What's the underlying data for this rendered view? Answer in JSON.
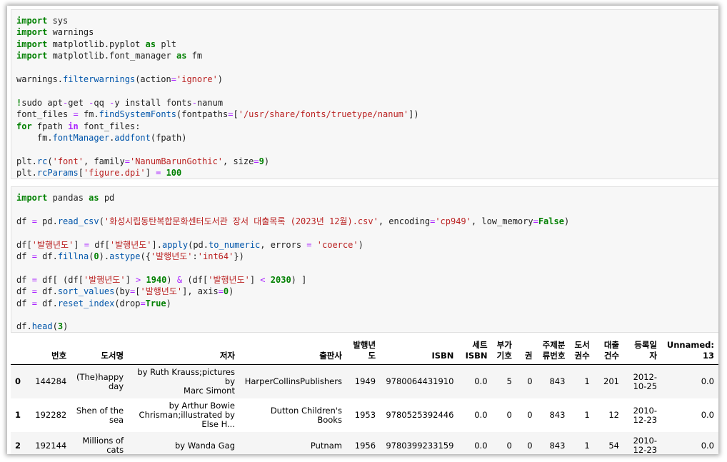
{
  "cells": [
    {
      "lines": [
        [
          {
            "t": "k",
            "v": "import"
          },
          {
            "t": "",
            "v": " sys"
          }
        ],
        [
          {
            "t": "k",
            "v": "import"
          },
          {
            "t": "",
            "v": " warnings"
          }
        ],
        [
          {
            "t": "k",
            "v": "import"
          },
          {
            "t": "",
            "v": " matplotlib.pyplot "
          },
          {
            "t": "k",
            "v": "as"
          },
          {
            "t": "",
            "v": " plt"
          }
        ],
        [
          {
            "t": "k",
            "v": "import"
          },
          {
            "t": "",
            "v": " matplotlib.font_manager "
          },
          {
            "t": "k",
            "v": "as"
          },
          {
            "t": "",
            "v": " fm"
          }
        ],
        [],
        [
          {
            "t": "",
            "v": "warnings."
          },
          {
            "t": "f",
            "v": "filterwarnings"
          },
          {
            "t": "",
            "v": "(action"
          },
          {
            "t": "o",
            "v": "="
          },
          {
            "t": "s",
            "v": "'ignore'"
          },
          {
            "t": "",
            "v": ")"
          }
        ],
        [],
        [
          {
            "t": "k",
            "v": "!"
          },
          {
            "t": "",
            "v": "sudo apt"
          },
          {
            "t": "o",
            "v": "-"
          },
          {
            "t": "",
            "v": "get "
          },
          {
            "t": "o",
            "v": "-"
          },
          {
            "t": "",
            "v": "qq "
          },
          {
            "t": "o",
            "v": "-"
          },
          {
            "t": "",
            "v": "y install fonts"
          },
          {
            "t": "o",
            "v": "-"
          },
          {
            "t": "",
            "v": "nanum"
          }
        ],
        [
          {
            "t": "",
            "v": "font_files "
          },
          {
            "t": "o",
            "v": "="
          },
          {
            "t": "",
            "v": " fm."
          },
          {
            "t": "f",
            "v": "findSystemFonts"
          },
          {
            "t": "",
            "v": "(fontpaths"
          },
          {
            "t": "o",
            "v": "="
          },
          {
            "t": "",
            "v": "["
          },
          {
            "t": "s",
            "v": "'/usr/share/fonts/truetype/nanum'"
          },
          {
            "t": "",
            "v": "])"
          }
        ],
        [
          {
            "t": "k",
            "v": "for"
          },
          {
            "t": "",
            "v": " fpath "
          },
          {
            "t": "n",
            "v": "in"
          },
          {
            "t": "",
            "v": " font_files:"
          }
        ],
        [
          {
            "t": "",
            "v": "    fm."
          },
          {
            "t": "f",
            "v": "fontManager"
          },
          {
            "t": "",
            "v": "."
          },
          {
            "t": "f",
            "v": "addfont"
          },
          {
            "t": "",
            "v": "(fpath)"
          }
        ],
        [],
        [
          {
            "t": "",
            "v": "plt."
          },
          {
            "t": "f",
            "v": "rc"
          },
          {
            "t": "",
            "v": "("
          },
          {
            "t": "s",
            "v": "'font'"
          },
          {
            "t": "",
            "v": ", family"
          },
          {
            "t": "o",
            "v": "="
          },
          {
            "t": "s",
            "v": "'NanumBarunGothic'"
          },
          {
            "t": "",
            "v": ", size"
          },
          {
            "t": "o",
            "v": "="
          },
          {
            "t": "k",
            "v": "9"
          },
          {
            "t": "",
            "v": ")"
          }
        ],
        [
          {
            "t": "",
            "v": "plt."
          },
          {
            "t": "f",
            "v": "rcParams"
          },
          {
            "t": "",
            "v": "["
          },
          {
            "t": "s",
            "v": "'figure.dpi'"
          },
          {
            "t": "",
            "v": "] "
          },
          {
            "t": "o",
            "v": "="
          },
          {
            "t": "",
            "v": " "
          },
          {
            "t": "k",
            "v": "100"
          }
        ]
      ]
    },
    {
      "lines": [
        [
          {
            "t": "k",
            "v": "import"
          },
          {
            "t": "",
            "v": " pandas "
          },
          {
            "t": "k",
            "v": "as"
          },
          {
            "t": "",
            "v": " pd"
          }
        ],
        [],
        [
          {
            "t": "",
            "v": "df "
          },
          {
            "t": "o",
            "v": "="
          },
          {
            "t": "",
            "v": " pd."
          },
          {
            "t": "f",
            "v": "read_csv"
          },
          {
            "t": "",
            "v": "("
          },
          {
            "t": "s",
            "v": "'화성시립동탄복합문화센터도서관 장서 대출목록 (2023년 12월).csv'"
          },
          {
            "t": "",
            "v": ", encoding"
          },
          {
            "t": "o",
            "v": "="
          },
          {
            "t": "s",
            "v": "'cp949'"
          },
          {
            "t": "",
            "v": ", low_memory"
          },
          {
            "t": "o",
            "v": "="
          },
          {
            "t": "k",
            "v": "False"
          },
          {
            "t": "",
            "v": ")"
          }
        ],
        [],
        [
          {
            "t": "",
            "v": "df["
          },
          {
            "t": "s",
            "v": "'발행년도'"
          },
          {
            "t": "",
            "v": "] "
          },
          {
            "t": "o",
            "v": "="
          },
          {
            "t": "",
            "v": " df["
          },
          {
            "t": "s",
            "v": "'발행년도'"
          },
          {
            "t": "",
            "v": "]."
          },
          {
            "t": "f",
            "v": "apply"
          },
          {
            "t": "",
            "v": "(pd."
          },
          {
            "t": "f",
            "v": "to_numeric"
          },
          {
            "t": "",
            "v": ", errors "
          },
          {
            "t": "o",
            "v": "="
          },
          {
            "t": "",
            "v": " "
          },
          {
            "t": "s",
            "v": "'coerce'"
          },
          {
            "t": "",
            "v": ")"
          }
        ],
        [
          {
            "t": "",
            "v": "df "
          },
          {
            "t": "o",
            "v": "="
          },
          {
            "t": "",
            "v": " df."
          },
          {
            "t": "f",
            "v": "fillna"
          },
          {
            "t": "",
            "v": "("
          },
          {
            "t": "k",
            "v": "0"
          },
          {
            "t": "",
            "v": ")."
          },
          {
            "t": "f",
            "v": "astype"
          },
          {
            "t": "",
            "v": "({"
          },
          {
            "t": "s",
            "v": "'발행년도'"
          },
          {
            "t": "",
            "v": ":"
          },
          {
            "t": "s",
            "v": "'int64'"
          },
          {
            "t": "",
            "v": "})"
          }
        ],
        [],
        [
          {
            "t": "",
            "v": "df "
          },
          {
            "t": "o",
            "v": "="
          },
          {
            "t": "",
            "v": " df[ (df["
          },
          {
            "t": "s",
            "v": "'발행년도'"
          },
          {
            "t": "",
            "v": "] "
          },
          {
            "t": "o",
            "v": ">"
          },
          {
            "t": "",
            "v": " "
          },
          {
            "t": "k",
            "v": "1940"
          },
          {
            "t": "",
            "v": ") "
          },
          {
            "t": "o",
            "v": "&"
          },
          {
            "t": "",
            "v": " (df["
          },
          {
            "t": "s",
            "v": "'발행년도'"
          },
          {
            "t": "",
            "v": "] "
          },
          {
            "t": "o",
            "v": "<"
          },
          {
            "t": "",
            "v": " "
          },
          {
            "t": "k",
            "v": "2030"
          },
          {
            "t": "",
            "v": ") ]"
          }
        ],
        [
          {
            "t": "",
            "v": "df "
          },
          {
            "t": "o",
            "v": "="
          },
          {
            "t": "",
            "v": " df."
          },
          {
            "t": "f",
            "v": "sort_values"
          },
          {
            "t": "",
            "v": "(by"
          },
          {
            "t": "o",
            "v": "="
          },
          {
            "t": "",
            "v": "["
          },
          {
            "t": "s",
            "v": "'발행년도'"
          },
          {
            "t": "",
            "v": "], axis"
          },
          {
            "t": "o",
            "v": "="
          },
          {
            "t": "k",
            "v": "0"
          },
          {
            "t": "",
            "v": ")"
          }
        ],
        [
          {
            "t": "",
            "v": "df "
          },
          {
            "t": "o",
            "v": "="
          },
          {
            "t": "",
            "v": " df."
          },
          {
            "t": "f",
            "v": "reset_index"
          },
          {
            "t": "",
            "v": "(drop"
          },
          {
            "t": "o",
            "v": "="
          },
          {
            "t": "k",
            "v": "True"
          },
          {
            "t": "",
            "v": ")"
          }
        ],
        [],
        [
          {
            "t": "",
            "v": "df."
          },
          {
            "t": "f",
            "v": "head"
          },
          {
            "t": "",
            "v": "("
          },
          {
            "t": "k",
            "v": "3"
          },
          {
            "t": "",
            "v": ")"
          }
        ]
      ]
    }
  ],
  "table": {
    "columns": [
      {
        "label": "",
        "width": 18
      },
      {
        "label": "번호",
        "width": 52
      },
      {
        "label": "도서명",
        "width": 70
      },
      {
        "label": "저자",
        "width": 176
      },
      {
        "label": "출판사",
        "width": 140
      },
      {
        "label": "발행년\n도",
        "width": 42
      },
      {
        "label": "ISBN",
        "width": 100
      },
      {
        "label": "세트\nISBN",
        "width": 40
      },
      {
        "label": "부가\n기호",
        "width": 36
      },
      {
        "label": "권",
        "width": 24
      },
      {
        "label": "주제분\n류번호",
        "width": 48
      },
      {
        "label": "도서\n권수",
        "width": 36
      },
      {
        "label": "대출\n건수",
        "width": 38
      },
      {
        "label": "등록일\n자",
        "width": 50
      },
      {
        "label": "Unnamed:\n13",
        "width": 70
      }
    ],
    "rows": [
      [
        "0",
        "144284",
        "(The)happy\nday",
        "by Ruth Krauss;pictures by\nMarc Simont",
        "HarperCollinsPublishers",
        "1949",
        "9780064431910",
        "0.0",
        "5",
        "0",
        "843",
        "1",
        "201",
        "2012-\n10-25",
        "0.0"
      ],
      [
        "1",
        "192282",
        "Shen of the\nsea",
        "by Arthur Bowie\nChrisman;illustrated by Else H...",
        "Dutton Children's\nBooks",
        "1953",
        "9780525392446",
        "0.0",
        "0",
        "0",
        "843",
        "1",
        "12",
        "2010-\n12-23",
        "0.0"
      ],
      [
        "2",
        "192144",
        "Millions of\ncats",
        "by Wanda Gag",
        "Putnam",
        "1956",
        "9780399233159",
        "0.0",
        "0",
        "0",
        "843",
        "1",
        "54",
        "2010-\n12-23",
        "0.0"
      ]
    ]
  }
}
